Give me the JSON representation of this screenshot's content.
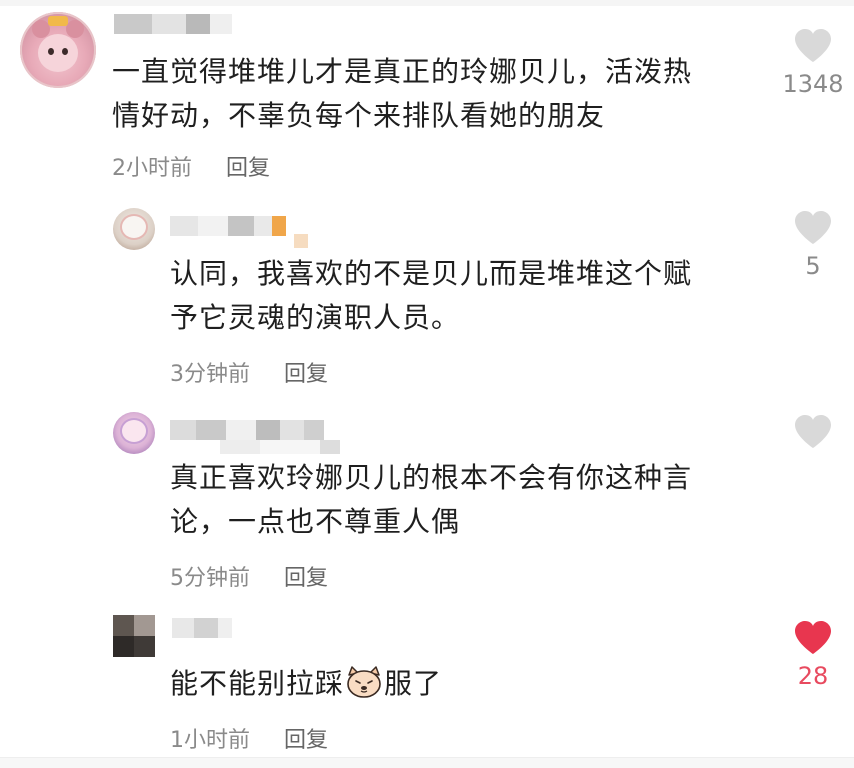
{
  "comments": [
    {
      "text_line1": "一直觉得堆堆儿才是真正的玲娜贝儿，活泼热",
      "text_line2": "情好动，不辜负每个来排队看她的朋友",
      "time": "2小时前",
      "reply": "回复",
      "like_count": "1348",
      "liked": false
    },
    {
      "text_line1": "认同，我喜欢的不是贝儿而是堆堆这个赋",
      "text_line2": "予它灵魂的演职人员。",
      "time": "3分钟前",
      "reply": "回复",
      "like_count": "5",
      "liked": false
    },
    {
      "text_line1": "真正喜欢玲娜贝儿的根本不会有你这种言",
      "text_line2": "论，一点也不尊重人偶",
      "time": "5分钟前",
      "reply": "回复",
      "like_count": "",
      "liked": false
    },
    {
      "text_before_emoji": "能不能别拉踩",
      "text_after_emoji": "服了",
      "emoji": "cat-face-emoji",
      "time": "1小时前",
      "reply": "回复",
      "like_count": "28",
      "liked": true
    }
  ],
  "colors": {
    "heart_inactive": "#d9d9d9",
    "heart_active": "#e8364f",
    "count_active": "#e84a5f",
    "meta_text": "#8a8a8a"
  },
  "icons": {
    "like": "heart-icon",
    "emoji": "cat-face-emoji"
  }
}
